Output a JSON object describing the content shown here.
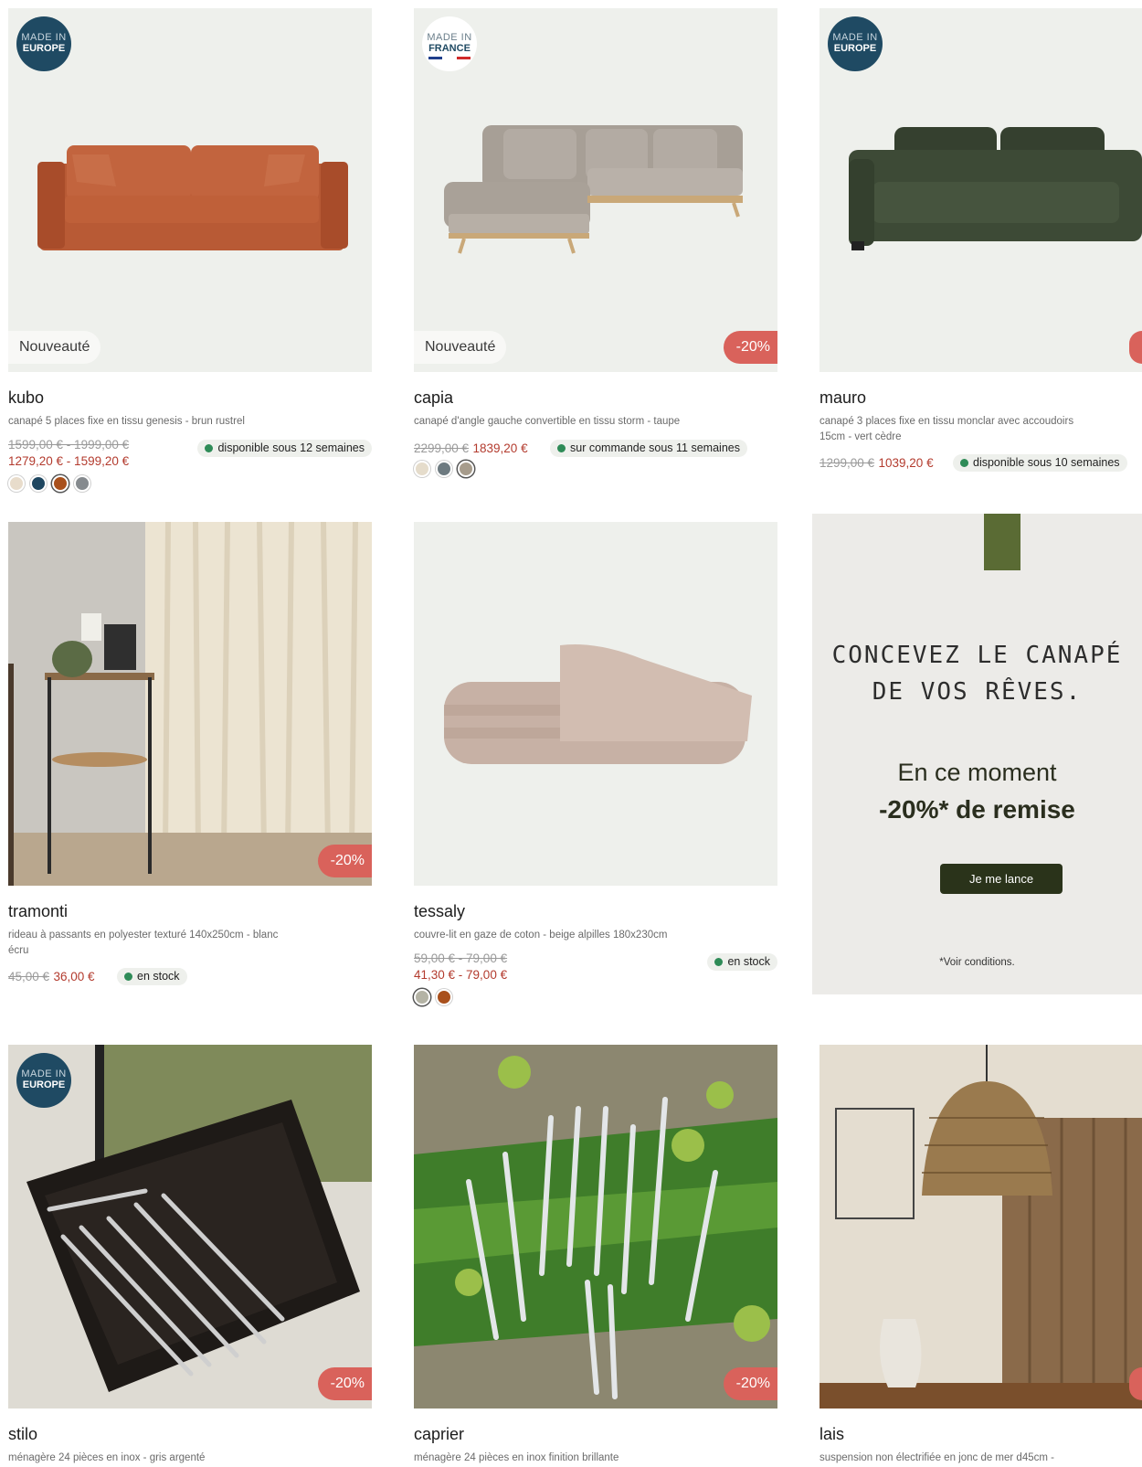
{
  "products": [
    {
      "name": "kubo",
      "desc": "canapé 5 places fixe en tissu genesis - brun rustrel",
      "old": "1599,00 € - 1999,00 €",
      "new": "1279,20 € - 1599,20 €",
      "stock": "disponible sous 12 semaines",
      "badge": "Nouveauté",
      "made_l1": "MADE IN",
      "made_l2": "EUROPE"
    },
    {
      "name": "capia",
      "desc": "canapé d'angle gauche convertible en tissu storm - taupe",
      "old": "2299,00 €",
      "new": "1839,20 €",
      "stock": "sur commande sous 11 semaines",
      "badge": "Nouveauté",
      "discount": "-20%",
      "made_l1": "MADE IN",
      "made_l2": "FRANCE"
    },
    {
      "name": "mauro",
      "desc": "canapé 3 places fixe en tissu monclar avec accoudoirs 15cm - vert cèdre",
      "old": "1299,00 €",
      "new": "1039,20 €",
      "stock": "disponible sous 10 semaines",
      "made_l1": "MADE IN",
      "made_l2": "EUROPE"
    },
    {
      "name": "tramonti",
      "desc": "rideau à passants en polyester texturé 140x250cm - blanc écru",
      "old": "45,00 €",
      "new": "36,00 €",
      "stock": "en stock",
      "discount": "-20%"
    },
    {
      "name": "tessaly",
      "desc": "couvre-lit en gaze de coton - beige alpilles 180x230cm",
      "old": "59,00 € - 79,00 €",
      "new": "41,30 € - 79,00 €",
      "stock": "en stock"
    },
    {
      "name": "stilo",
      "desc": "ménagère 24 pièces en inox - gris argenté",
      "discount": "-20%",
      "made_l1": "MADE IN",
      "made_l2": "EUROPE"
    },
    {
      "name": "caprier",
      "desc": "ménagère 24 pièces en inox finition brillante",
      "discount": "-20%"
    },
    {
      "name": "lais",
      "desc": "suspension non électrifiée en jonc de mer d45cm -"
    }
  ],
  "swatches": {
    "kubo": [
      "#e8dccb",
      "#1e4660",
      "#a9501c",
      "#858a8e"
    ],
    "capia": [
      "#e5dccb",
      "#6d7a80",
      "#a79c8c"
    ],
    "tessaly": [
      "#b4b3a5",
      "#a9501c"
    ]
  },
  "promo": {
    "script_line1": "CONCEVEZ LE CANAPÉ",
    "script_line2": "DE VOS RÊVES.",
    "line1": "En ce moment",
    "line2": "-20%* de remise",
    "cta": "Je me lance",
    "conditions": "*Voir conditions."
  },
  "colors": {
    "accent_price": "#b33b2e",
    "discount_badge": "#d9625b",
    "stock_dot": "#2e8b57",
    "made_badge": "#1f4a63",
    "cta": "#2a331a"
  }
}
